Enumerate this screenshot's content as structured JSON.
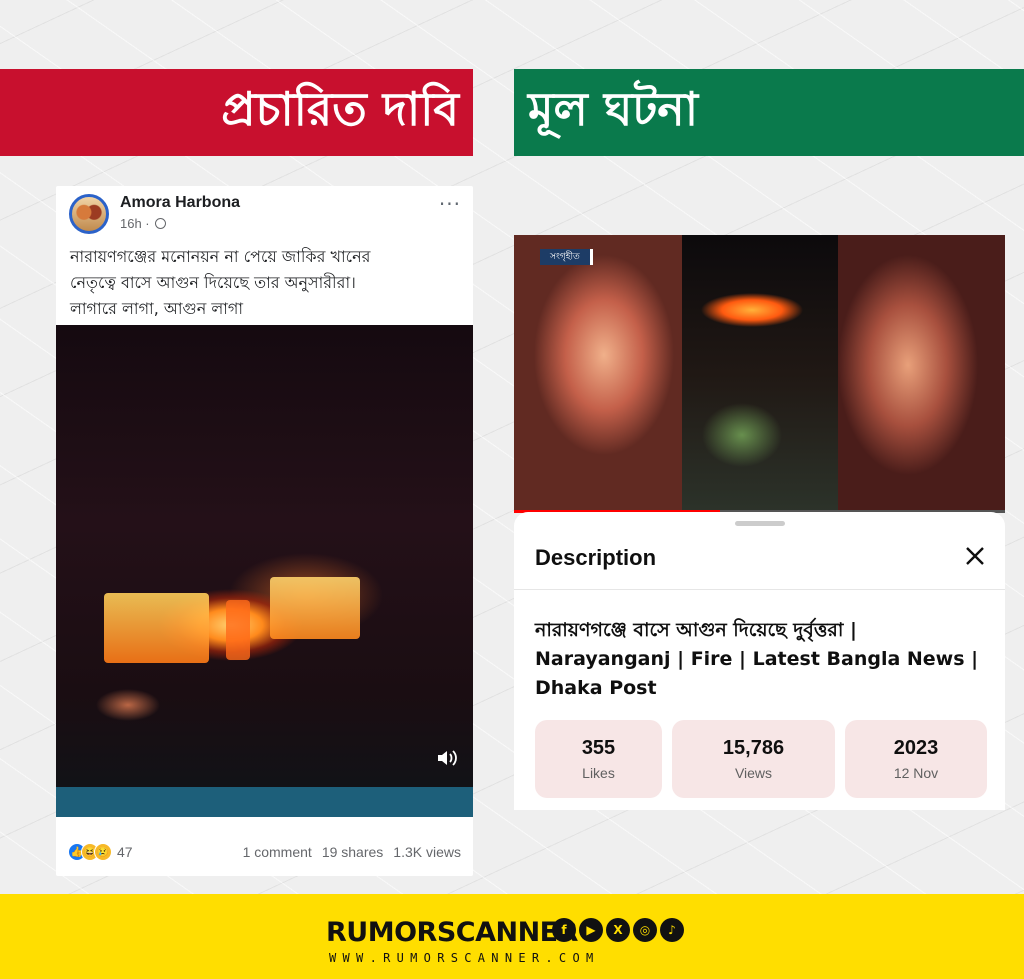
{
  "banners": {
    "left": "প্রচারিত দাবি",
    "right": "মূল ঘটনা"
  },
  "facebook_post": {
    "author": "Amora Harbona",
    "time": "16h ·",
    "text": "নারায়ণগঞ্জের মনোনয়ন না পেয়ে জাকির খানের\nনেতৃত্বে বাসে আগুন দিয়েছে তার অনুসারীরা।\nলাগারে লাগা, আগুন লাগা",
    "more_icon": "···",
    "reaction_count": "47",
    "comments": "1 comment",
    "shares": "19 shares",
    "views": "1.3K views"
  },
  "video": {
    "badge": "সংগৃহীত",
    "progress": 0.42
  },
  "description": {
    "heading": "Description",
    "title": "নারায়ণগঞ্জে বাসে আগুন দিয়েছে দুর্বৃত্তরা | Narayanganj | Fire | Latest Bangla News | Dhaka Post",
    "stats": [
      {
        "value": "355",
        "label": "Likes"
      },
      {
        "value": "15,786",
        "label": "Views"
      },
      {
        "value": "2023",
        "label": "12 Nov"
      }
    ]
  },
  "footer": {
    "brand": "RUMORSCANNER",
    "url": "WWW.RUMORSCANNER.COM",
    "social_icons": [
      "facebook-icon",
      "youtube-icon",
      "x-icon",
      "instagram-icon",
      "tiktok-icon"
    ]
  },
  "colors": {
    "claim_red": "#c8102e",
    "fact_green": "#0a7a4c",
    "footer_yellow": "#ffde00"
  }
}
